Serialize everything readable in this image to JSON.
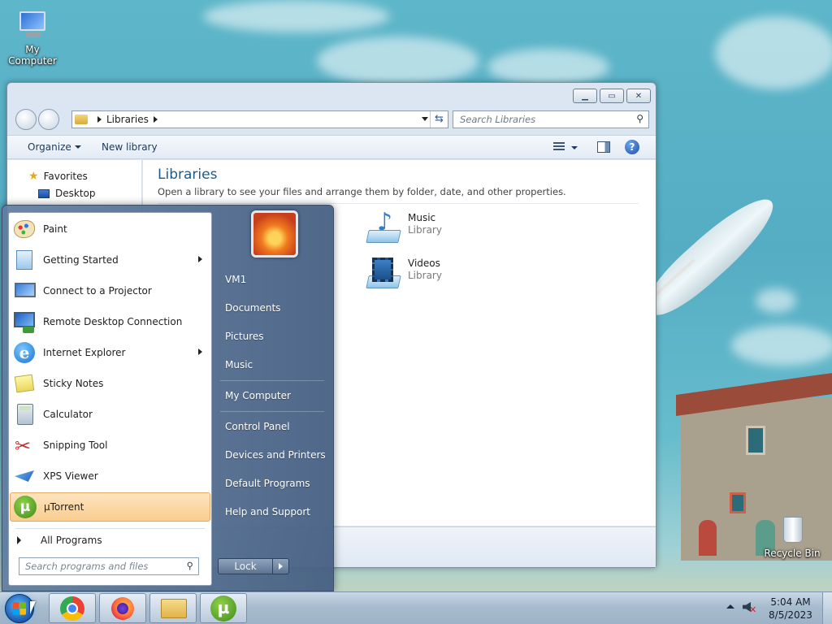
{
  "desktop": {
    "icons": [
      {
        "label": "My Computer"
      },
      {
        "label": "Recycle Bin"
      }
    ]
  },
  "explorer": {
    "breadcrumb": [
      "Libraries"
    ],
    "search_placeholder": "Search Libraries",
    "toolbar": {
      "organize": "Organize",
      "new_library": "New library"
    },
    "nav_pane": [
      {
        "label": "Favorites",
        "icon": "star-icon"
      },
      {
        "label": "Desktop",
        "icon": "desktop-icon"
      }
    ],
    "content": {
      "title": "Libraries",
      "subtitle": "Open a library to see your files and arrange them by folder, date, and other properties.",
      "libraries": [
        {
          "name": "Music",
          "type": "Library",
          "icon": "music-library-icon"
        },
        {
          "name": "Videos",
          "type": "Library",
          "icon": "videos-library-icon"
        }
      ]
    }
  },
  "start_menu": {
    "programs": [
      {
        "label": "Paint",
        "icon": "paint-icon",
        "submenu": false
      },
      {
        "label": "Getting Started",
        "icon": "getting-started-icon",
        "submenu": true
      },
      {
        "label": "Connect to a Projector",
        "icon": "projector-icon",
        "submenu": false
      },
      {
        "label": "Remote Desktop Connection",
        "icon": "remote-desktop-icon",
        "submenu": false
      },
      {
        "label": "Internet Explorer",
        "icon": "internet-explorer-icon",
        "submenu": true
      },
      {
        "label": "Sticky Notes",
        "icon": "sticky-notes-icon",
        "submenu": false
      },
      {
        "label": "Calculator",
        "icon": "calculator-icon",
        "submenu": false
      },
      {
        "label": "Snipping Tool",
        "icon": "snipping-tool-icon",
        "submenu": false
      },
      {
        "label": "XPS Viewer",
        "icon": "xps-viewer-icon",
        "submenu": false
      },
      {
        "label": "µTorrent",
        "icon": "utorrent-icon",
        "submenu": false,
        "highlighted": true
      }
    ],
    "all_programs": "All Programs",
    "search_placeholder": "Search programs and files",
    "right_items": [
      "VM1",
      "Documents",
      "Pictures",
      "Music",
      "My Computer",
      "Control Panel",
      "Devices and Printers",
      "Default Programs",
      "Help and Support"
    ],
    "lock_label": "Lock"
  },
  "taskbar": {
    "pinned": [
      "chrome-icon",
      "firefox-icon",
      "explorer-folder-icon",
      "utorrent-icon"
    ],
    "clock": {
      "time": "5:04 AM",
      "date": "8/5/2023"
    }
  }
}
